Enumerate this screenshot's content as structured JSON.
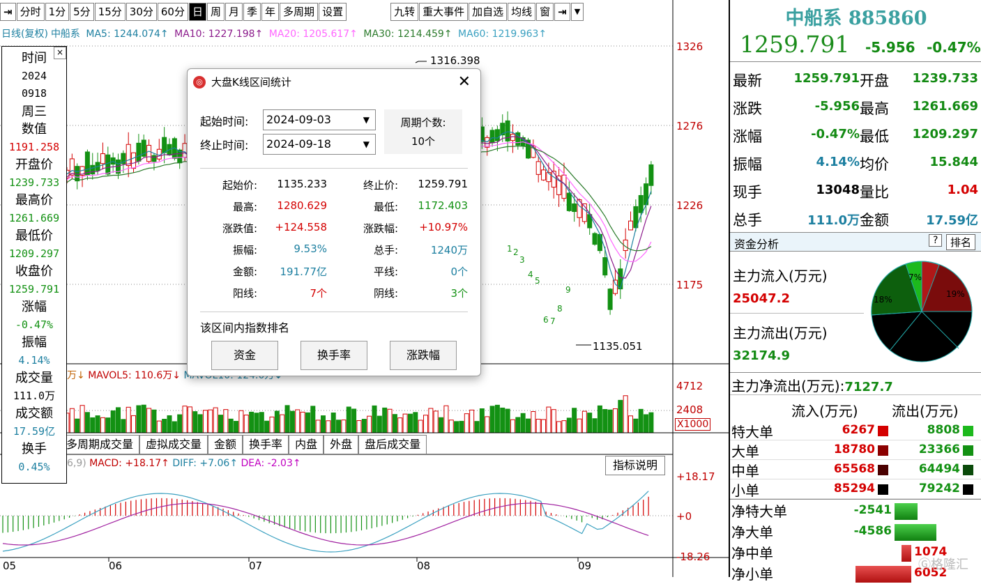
{
  "toolbar": {
    "items": [
      "分时",
      "1分",
      "5分",
      "15分",
      "30分",
      "60分",
      "日",
      "周",
      "月",
      "季",
      "年",
      "多周期",
      "设置"
    ],
    "right_items": [
      "九转",
      "重大事件",
      "加自选",
      "均线",
      "窗"
    ]
  },
  "ma_line": {
    "mode": "日线(复权)",
    "name": "中船系",
    "ma5": "MA5: 1244.074↑",
    "ma10": "MA10: 1227.198↑",
    "ma20": "MA20: 1205.617↑",
    "ma30": "MA30: 1214.459↑",
    "ma60": "MA60: 1219.963↑"
  },
  "colors": {
    "up": "#d40000",
    "down": "#139113",
    "ma5": "#1c7fa0",
    "ma10": "#8b1a8b",
    "ma20": "#ff66ff",
    "ma30": "#2a7a2a",
    "ma60": "#3aa0c0"
  },
  "info_panel": {
    "rows": [
      {
        "label": "时间"
      },
      {
        "value": "2024"
      },
      {
        "value": "0918"
      },
      {
        "label": "周三"
      },
      {
        "label": "数值"
      },
      {
        "value": "1191.258",
        "color": "#d40000"
      },
      {
        "label": "开盘价"
      },
      {
        "value": "1239.733",
        "color": "#139113"
      },
      {
        "label": "最高价"
      },
      {
        "value": "1261.669",
        "color": "#139113"
      },
      {
        "label": "最低价"
      },
      {
        "value": "1209.297",
        "color": "#139113"
      },
      {
        "label": "收盘价"
      },
      {
        "value": "1259.791",
        "color": "#139113"
      },
      {
        "label": "涨幅"
      },
      {
        "value": "-0.47%",
        "color": "#139113"
      },
      {
        "label": "振幅"
      },
      {
        "value": "4.14%",
        "color": "#1c7fa0"
      },
      {
        "label": "成交量"
      },
      {
        "value": "111.0万"
      },
      {
        "label": "成交额"
      },
      {
        "value": "17.59亿",
        "color": "#1c7fa0"
      },
      {
        "label": "换手"
      },
      {
        "value": "0.45%",
        "color": "#1c7fa0"
      }
    ]
  },
  "price_axis": [
    "1326",
    "1276",
    "1226",
    "1175"
  ],
  "annotations": {
    "high": "1316.398",
    "low": "1135.051"
  },
  "volume": {
    "mavol5": "MAVOL5: 110.6万↓",
    "mavol10": "MAVOL10: 124.0万↓",
    "lead": "万↓",
    "axis": [
      "4712",
      "2408",
      "X1000"
    ]
  },
  "vol_tabs": [
    "多周期成交量",
    "虚拟成交量",
    "金额",
    "换手率",
    "内盘",
    "外盘",
    "盘后成交量"
  ],
  "macd": {
    "prefix": "6,9)",
    "macd": "MACD: +18.17↑",
    "diff": "DIFF: +7.06↑",
    "dea": "DEA: -2.03↑",
    "axis": [
      "+18.17",
      "+0",
      "-18.26"
    ],
    "explain": "指标说明"
  },
  "x_axis": [
    "05",
    "06",
    "07",
    "08",
    "09"
  ],
  "right_panel": {
    "title": "中船系 885860",
    "price": "1259.791",
    "change": "-5.956",
    "pct": "-0.47%",
    "quotes": [
      {
        "l1": "最新",
        "v1": "1259.791",
        "c1": "green",
        "l2": "开盘",
        "v2": "1239.733",
        "c2": "green"
      },
      {
        "l1": "涨跌",
        "v1": "-5.956",
        "c1": "green",
        "l2": "最高",
        "v2": "1261.669",
        "c2": "green"
      },
      {
        "l1": "涨幅",
        "v1": "-0.47%",
        "c1": "green",
        "l2": "最低",
        "v2": "1209.297",
        "c2": "green"
      },
      {
        "l1": "振幅",
        "v1": "4.14%",
        "c1": "teal",
        "l2": "均价",
        "v2": "15.844",
        "c2": "green"
      },
      {
        "l1": "现手",
        "v1": "13048",
        "c1": "black",
        "l2": "量比",
        "v2": "1.04",
        "c2": "red"
      },
      {
        "l1": "总手",
        "v1": "111.0万",
        "c1": "teal",
        "l2": "金额",
        "v2": "17.59亿",
        "c2": "teal"
      }
    ],
    "fund_header": "资金分析",
    "help": "?",
    "rank": "排名",
    "inflow_label": "主力流入(万元)",
    "inflow_value": "25047.2",
    "outflow_label": "主力流出(万元)",
    "outflow_value": "32174.9",
    "net_label": "主力净流出(万元):",
    "net_value": "7127.7",
    "pie_labels": [
      "7%",
      "19%",
      "18%"
    ],
    "flow_head_in": "流入(万元)",
    "flow_head_out": "流出(万元)",
    "flows": [
      {
        "label": "特大单",
        "in": "6267",
        "out": "8808",
        "inc": "#d40000",
        "outc": "#1db91d"
      },
      {
        "label": "大单",
        "in": "18780",
        "out": "23366",
        "inc": "#8b0000",
        "outc": "#139113"
      },
      {
        "label": "中单",
        "in": "65568",
        "out": "64494",
        "inc": "#4a0000",
        "outc": "#0a4a0a"
      },
      {
        "label": "小单",
        "in": "85294",
        "out": "79242",
        "inc": "#000000",
        "outc": "#000000"
      }
    ],
    "nets": [
      {
        "label": "净特大单",
        "value": "-2541",
        "color": "green",
        "bar": 0.33
      },
      {
        "label": "净大单",
        "value": "-4586",
        "color": "green",
        "bar": 0.6
      },
      {
        "label": "净中单",
        "value": "1074",
        "color": "red",
        "bar": 0.14
      },
      {
        "label": "净小单",
        "value": "6052",
        "color": "red",
        "bar": 0.8
      }
    ],
    "watermark": "格隆汇"
  },
  "dialog": {
    "title": "大盘K线区间统计",
    "start_label": "起始时间:",
    "start_value": "2024-09-03",
    "end_label": "终止时间:",
    "end_value": "2024-09-18",
    "period_label": "周期个数:",
    "period_value": "10个",
    "stats": [
      {
        "l": "起始价:",
        "v": "1135.233",
        "vc": "#000",
        "l2": "终止价:",
        "v2": "1259.791",
        "v2c": "#000"
      },
      {
        "l": "最高:",
        "v": "1280.629",
        "vc": "#d40000",
        "l2": "最低:",
        "v2": "1172.403",
        "v2c": "#139113"
      },
      {
        "l": "涨跌值:",
        "v": "+124.558",
        "vc": "#d40000",
        "l2": "涨跌幅:",
        "v2": "+10.97%",
        "v2c": "#d40000"
      },
      {
        "l": "振幅:",
        "v": "9.53%",
        "vc": "#1c7fa0",
        "l2": "总手:",
        "v2": "1240万",
        "v2c": "#1c7fa0"
      },
      {
        "l": "金额:",
        "v": "191.77亿",
        "vc": "#1c7fa0",
        "l2": "平线:",
        "v2": "0个",
        "v2c": "#1c7fa0"
      },
      {
        "l": "阳线:",
        "v": "7个",
        "vc": "#d40000",
        "l2": "阴线:",
        "v2": "3个",
        "v2c": "#139113"
      }
    ],
    "rank_label": "该区间内指数排名",
    "buttons": [
      "资金",
      "换手率",
      "涨跌幅"
    ]
  }
}
